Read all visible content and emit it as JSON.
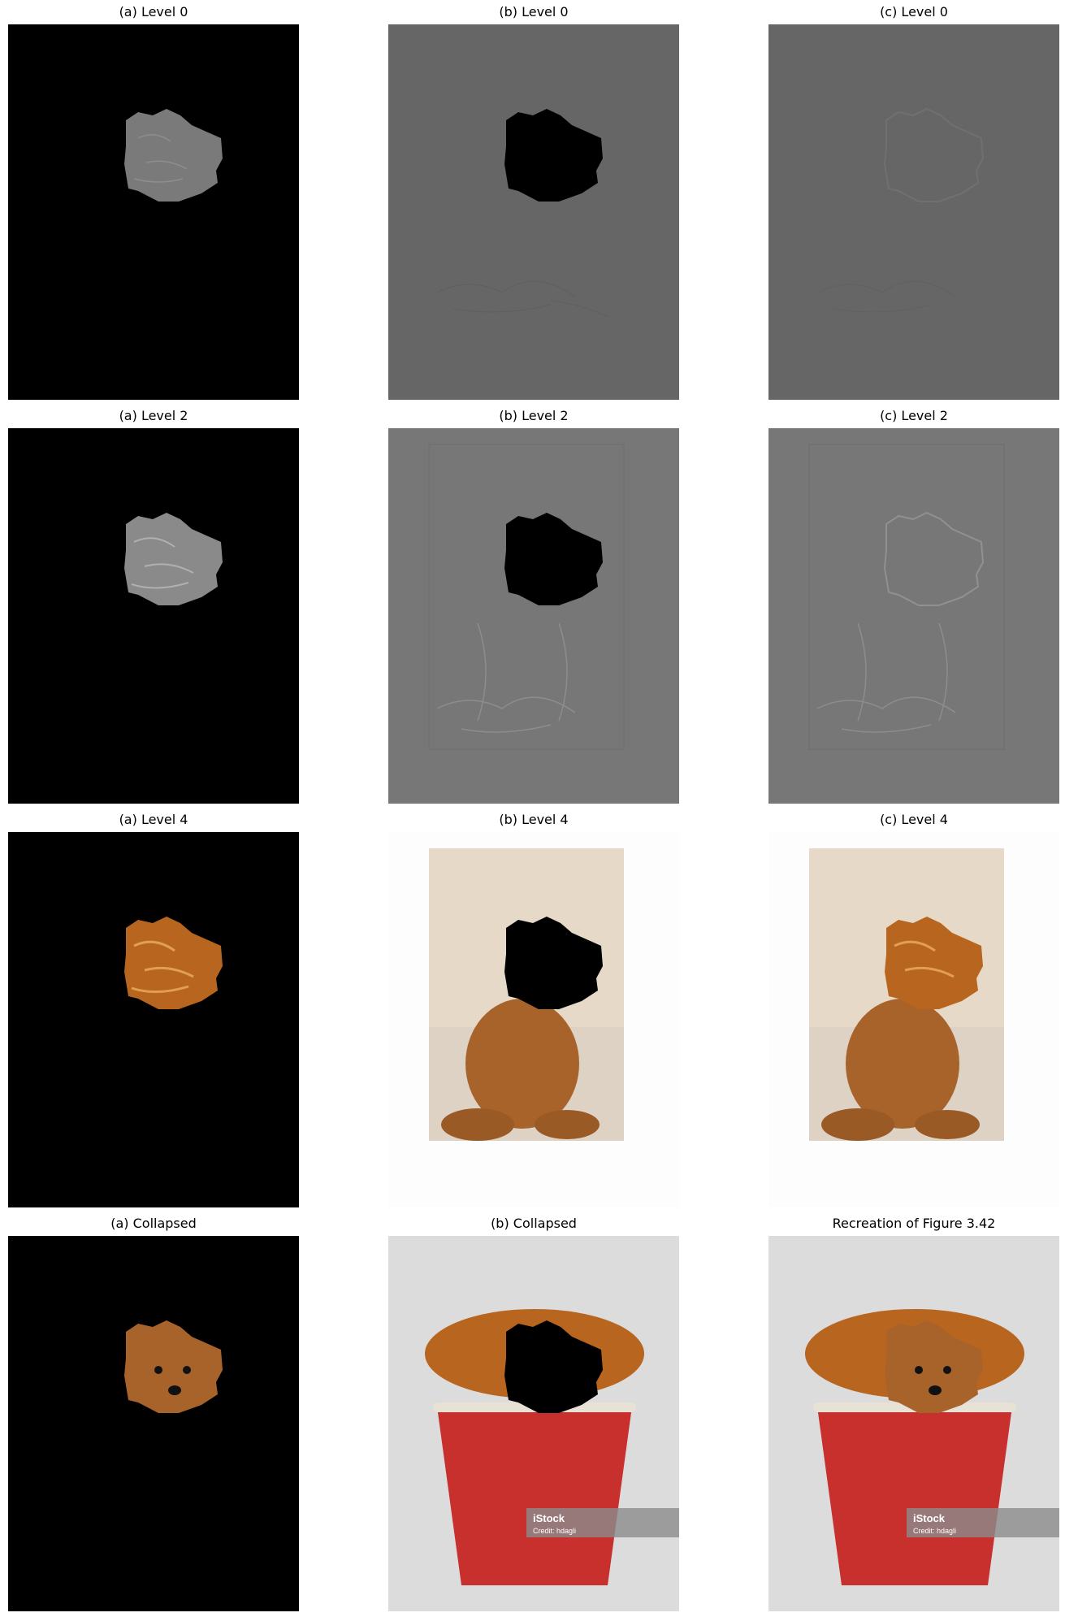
{
  "panels": [
    {
      "title": "(a) Level 0"
    },
    {
      "title": "(b) Level 0"
    },
    {
      "title": "(c) Level 0"
    },
    {
      "title": "(a) Level 2"
    },
    {
      "title": "(b) Level 2"
    },
    {
      "title": "(c) Level 2"
    },
    {
      "title": "(a) Level 4"
    },
    {
      "title": "(b) Level 4"
    },
    {
      "title": "(c) Level 4"
    },
    {
      "title": "(a) Collapsed"
    },
    {
      "title": "(b) Collapsed"
    },
    {
      "title": "Recreation of Figure 3.42"
    }
  ],
  "watermark": {
    "brand": "iStock",
    "credit": "Credit: hdagli"
  },
  "colors": {
    "black": "#000000",
    "gray_level0": "#666666",
    "gray_level2": "#777777",
    "chicken": "#b8651f",
    "poodle": "#a8632b",
    "bucket": "#c8302e",
    "backdrop": "#dcdcdc"
  }
}
